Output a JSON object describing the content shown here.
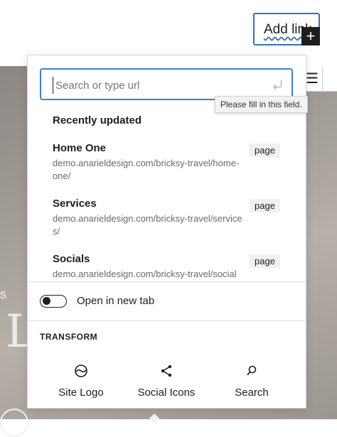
{
  "toolbar": {
    "add_link_label": "Add link",
    "plus_label": "+",
    "menu_glyph": "☰"
  },
  "canvas": {
    "hero_small_text": "s",
    "hero_letter": "L"
  },
  "link_popover": {
    "search": {
      "placeholder": "Search or type url",
      "value": ""
    },
    "validation_tooltip": "Please fill in this field.",
    "recently_updated_title": "Recently updated",
    "results": [
      {
        "title": "Home One",
        "url": "demo.anarieldesign.com/bricksy-travel/home-one/",
        "type": "page"
      },
      {
        "title": "Services",
        "url": "demo.anarieldesign.com/bricksy-travel/services/",
        "type": "page"
      },
      {
        "title": "Socials",
        "url": "demo.anarieldesign.com/bricksy-travel/socials/",
        "type": "page"
      }
    ],
    "open_in_new_tab_label": "Open in new tab",
    "open_in_new_tab_enabled": false,
    "transform_title": "TRANSFORM",
    "transforms": [
      {
        "label": "Site Logo",
        "icon": "site-logo-icon"
      },
      {
        "label": "Social Icons",
        "icon": "share-icon"
      },
      {
        "label": "Search",
        "icon": "search-icon"
      }
    ]
  },
  "colors": {
    "focus_blue": "#3b7fcf",
    "text": "#1e1e1e",
    "muted": "#6b6b6b"
  }
}
